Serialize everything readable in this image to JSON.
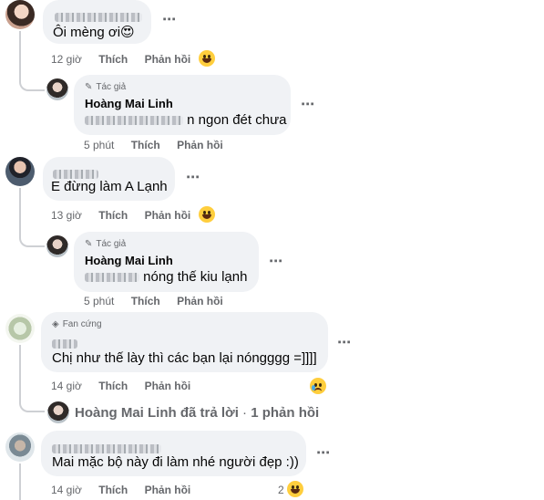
{
  "comments": [
    {
      "author_blurred": true,
      "text": "Ôi mèng ơi😍",
      "time": "12 giờ",
      "like": "Thích",
      "reply": "Phản hồi",
      "reaction": "laugh",
      "replies": [
        {
          "badge": "Tác giả",
          "author": "Hoàng Mai Linh",
          "text_visible": "n ngon đét chưa",
          "time": "5 phút",
          "like": "Thích",
          "reply": "Phản hồi"
        }
      ]
    },
    {
      "author_blurred": true,
      "text": "E đừng làm A Lạnh",
      "time": "13 giờ",
      "like": "Thích",
      "reply": "Phản hồi",
      "reaction": "laugh",
      "replies": [
        {
          "badge": "Tác giả",
          "author": "Hoàng Mai Linh",
          "text_visible": "nóng thế kiu lạnh",
          "time": "5 phút",
          "like": "Thích",
          "reply": "Phản hồi"
        }
      ]
    },
    {
      "badge": "Fan cứng",
      "author_blurred": true,
      "text": "Chị như thế lày thì các bạn lại nóngggg =]]]]",
      "time": "14 giờ",
      "like": "Thích",
      "reply": "Phản hồi",
      "reaction": "sad",
      "reply_summary": {
        "name": "Hoàng Mai Linh",
        "action": "đã trả lời",
        "separator": "·",
        "count": "1 phản hồi"
      }
    },
    {
      "author_blurred": true,
      "text": "Mai mặc bộ này đi làm nhé người đẹp :))",
      "time": "14 giờ",
      "like": "Thích",
      "reply": "Phản hồi",
      "reaction_count": "2",
      "reaction": "laugh"
    }
  ],
  "more_icon": "⋯",
  "icons": {
    "author_badge": "pencil-icon",
    "fan_badge": "diamond-icon"
  },
  "colors": {
    "bubble": "#f0f2f5",
    "meta": "#65676b",
    "emoji": "#ffce3d"
  }
}
